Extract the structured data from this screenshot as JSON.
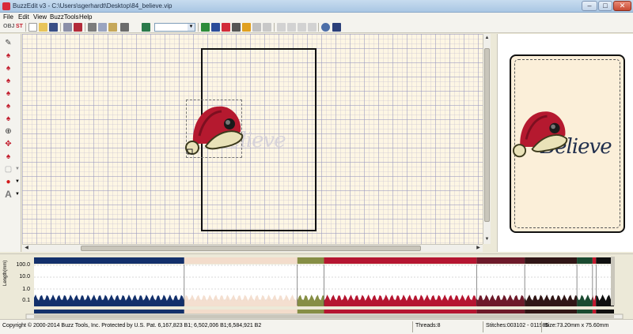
{
  "window": {
    "title": "BuzzEdit v3 - C:\\Users\\sgerhardt\\Desktop\\84_believe.vip",
    "minimize": "–",
    "maximize": "□",
    "close": "✕"
  },
  "menu": [
    "File",
    "Edit",
    "View",
    "BuzzTools",
    "Help"
  ],
  "toolbar": {
    "obj_label": "OBJ",
    "st_label": "ST",
    "zoom_value": "",
    "icons": [
      "new-icon",
      "open-icon",
      "save-icon",
      "stitch-icon",
      "stitch-red-icon",
      "cut-icon",
      "copy-icon",
      "paste-icon",
      "print-icon",
      "thread-icon",
      "grid-icon",
      "tie-icon",
      "move-icon",
      "rotate-icon",
      "flag-icon",
      "size-icon",
      "center-icon",
      "undo-icon",
      "redo-icon",
      "wand-icon",
      "zoom-icon",
      "help-icon"
    ],
    "colors": {
      "accent": "#d22b39",
      "green": "#2d8c3a",
      "blue": "#2b4c9a"
    }
  },
  "left_tools": [
    "select-icon",
    "santa-tool-icon",
    "santa-tool-icon",
    "santa-tool-icon",
    "santa-tool-icon",
    "santa-tool-icon",
    "santa-tool-icon",
    "zoom-tool-icon",
    "move-tool-icon",
    "measure-tool-icon",
    "snap-tool-icon",
    "color-picker-icon",
    "text-tool-icon"
  ],
  "canvas": {
    "ghost_text": "Believe",
    "background": "#fdf6e4"
  },
  "preview": {
    "text": "Believe",
    "background": "#fbefd9",
    "text_color": "#22304e"
  },
  "graph": {
    "ylabel": "Length(mm)",
    "yticks": [
      "100.0",
      "10.0",
      "1.0",
      "0.1"
    ],
    "color_blocks": [
      {
        "color": "#13306b",
        "from": 0.0,
        "to": 0.259
      },
      {
        "color": "#f3dccb",
        "from": 0.259,
        "to": 0.454
      },
      {
        "color": "#868e45",
        "from": 0.454,
        "to": 0.5
      },
      {
        "color": "#b51631",
        "from": 0.5,
        "to": 0.763
      },
      {
        "color": "#6d1a2a",
        "from": 0.763,
        "to": 0.846
      },
      {
        "color": "#301616",
        "from": 0.846,
        "to": 0.936
      },
      {
        "color": "#1a4a30",
        "from": 0.936,
        "to": 0.963
      },
      {
        "color": "#c4192f",
        "from": 0.963,
        "to": 0.969
      },
      {
        "color": "#101010",
        "from": 0.969,
        "to": 1.0
      }
    ]
  },
  "status": {
    "copyright": "Copyright © 2000-2014 Buzz Tools, Inc. Protected by U.S. Pat. 6,167,823 B1; 6,502,006 B1;6,584,921 B2",
    "threads": "Threads:8",
    "stitches": "Stitches:003102 - 011986",
    "size": "Size:73.20mm x 75.60mm"
  }
}
